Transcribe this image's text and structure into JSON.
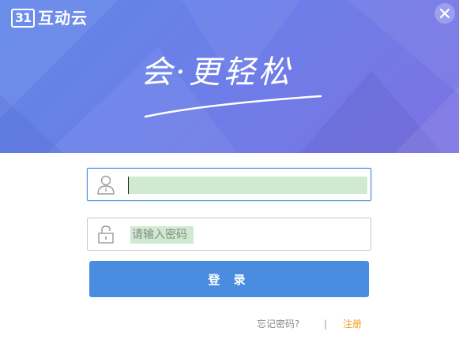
{
  "app": {
    "logo_mark": "31",
    "logo_text": "互动云"
  },
  "banner": {
    "slogan": "会·更轻松",
    "colors": {
      "gradient_start": "#5f86ea",
      "gradient_end": "#7c72e3"
    }
  },
  "form": {
    "username": {
      "icon": "user-icon",
      "value": "",
      "placeholder": ""
    },
    "password": {
      "icon": "lock-icon",
      "value": "",
      "placeholder": "请输入密码"
    },
    "login_label": "登 录"
  },
  "links": {
    "forgot_password": "忘记密码?",
    "separator": "|",
    "register": "注册"
  },
  "colors": {
    "accent": "#4a8de0",
    "register_link": "#f0a020"
  },
  "icons": {
    "close": "close-icon"
  }
}
